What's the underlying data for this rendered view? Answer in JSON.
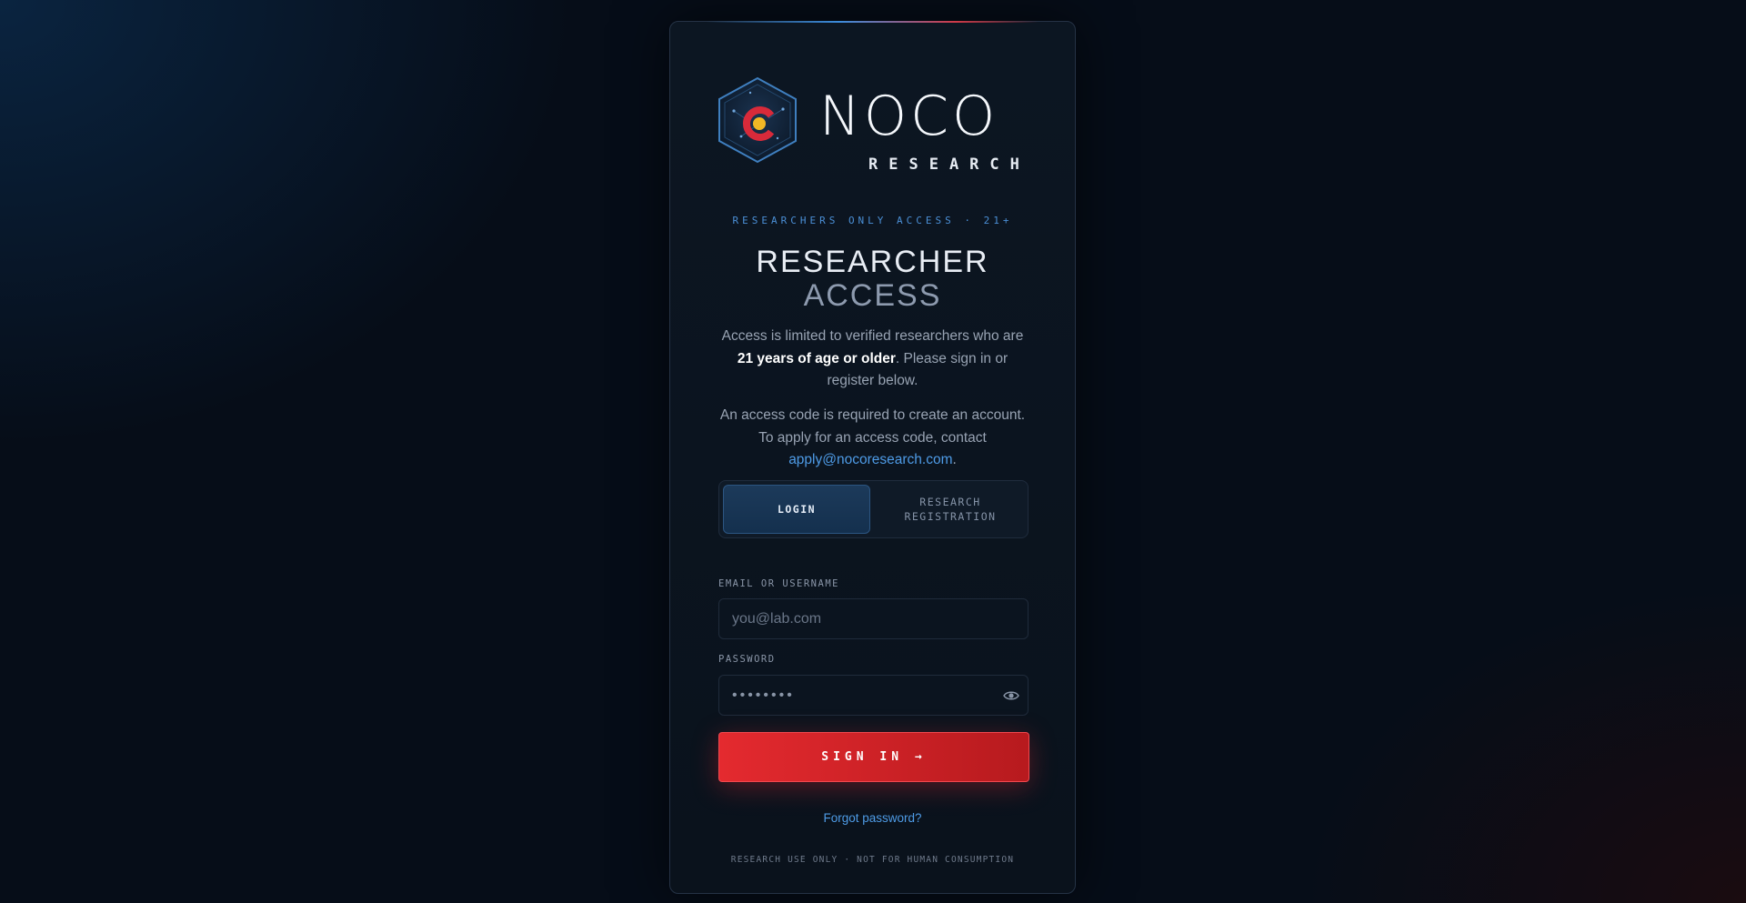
{
  "brand": {
    "logo_icon": "hexagon-colorado-c-icon",
    "name": "NOCO",
    "sub": "RESEARCH"
  },
  "eyebrow": "RESEARCHERS ONLY ACCESS · 21+",
  "title": {
    "line1": "RESEARCHER",
    "line2": "ACCESS"
  },
  "intro": {
    "before_bold": "Access is limited to verified researchers who are ",
    "bold": "21 years of age or older",
    "after_bold": ". Please sign in or register below."
  },
  "access_code": {
    "text": "An access code is required to create an account. To apply for an access code, contact ",
    "email": "apply@nocoresearch.com",
    "suffix": "."
  },
  "tabs": [
    {
      "label": "LOGIN",
      "active": true
    },
    {
      "label": "RESEARCH\nREGISTRATION",
      "active": false
    }
  ],
  "form": {
    "email_label": "EMAIL OR USERNAME",
    "email_placeholder": "you@lab.com",
    "email_value": "",
    "password_label": "PASSWORD",
    "password_placeholder": "••••••••",
    "password_toggle_icon": "eye-icon",
    "submit_label": "SIGN IN →"
  },
  "forgot_label": "Forgot password?",
  "footer": "RESEARCH USE ONLY · NOT FOR HUMAN CONSUMPTION",
  "colors": {
    "accent_blue": "#4e9be6",
    "accent_red": "#e42a2f",
    "background": "#060d18",
    "card": "#0c1622"
  }
}
